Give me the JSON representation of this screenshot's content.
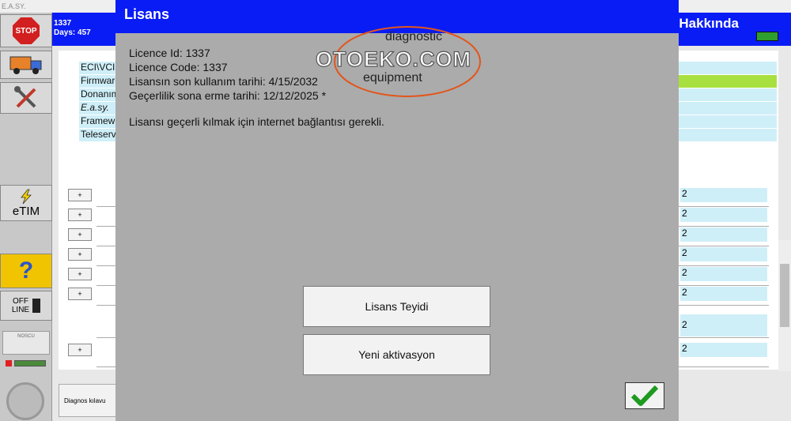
{
  "app": {
    "title": "E.A.SY."
  },
  "header": {
    "line1": "1337",
    "line2": "Days: 457",
    "title": "Hakkında"
  },
  "sidebar": {
    "stop_label": "STOP",
    "etim_label": "eTIM",
    "help_label": "?",
    "offline_label_1": "OFF",
    "offline_label_2": "LINE",
    "nosecu_label": "NOSCU"
  },
  "info_rows": [
    "ECI\\VCI",
    "Firmware",
    "Donanım",
    "E.a.sy.",
    "Framework",
    "Teleservice"
  ],
  "list_rows": [
    {
      "plus": "+",
      "right": "2"
    },
    {
      "plus": "+",
      "right": "2"
    },
    {
      "plus": "+",
      "right": "2"
    },
    {
      "plus": "+",
      "right": "2"
    },
    {
      "plus": "+",
      "right": "2"
    },
    {
      "plus": "+",
      "right": "2"
    },
    {
      "plus": "",
      "right": "2"
    },
    {
      "plus": "+",
      "right": "2"
    }
  ],
  "footer": {
    "guide_label": "Diagnos kılavu"
  },
  "dialog": {
    "title": "Lisans",
    "licence_id": "Licence Id: 1337",
    "licence_code": "Licence Code: 1337",
    "last_use": "Lisansın son kullanım tarihi: 4/15/2032",
    "expiry": "Geçerlilik sona erme tarihi: 12/12/2025 *",
    "note": "Lisansı geçerli kılmak için internet bağlantısı gerekli.",
    "confirm_label": "Lisans Teyidi",
    "activate_label": "Yeni aktivasyon"
  },
  "watermark": {
    "top": "diagnostic",
    "main": "OTOEKO.COM",
    "bottom": "equipment"
  },
  "colors": {
    "header_blue": "#0a1cf5",
    "dialog_gray": "#ababab",
    "row_cyan": "#cfeff8",
    "row_green": "#a8e040",
    "check_green": "#1e9a1e",
    "watermark_orange": "#e2561b"
  }
}
